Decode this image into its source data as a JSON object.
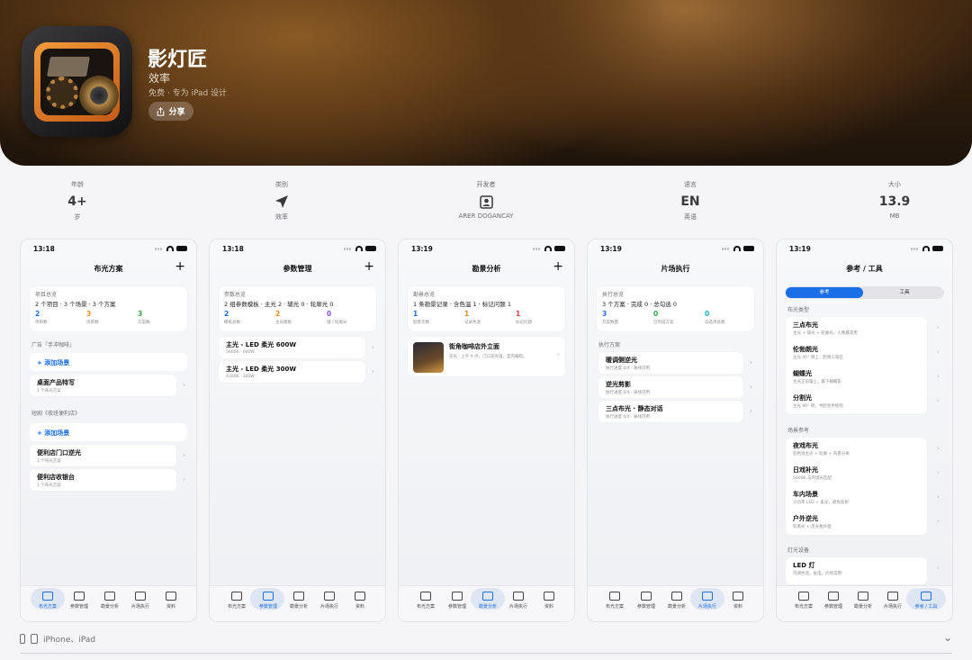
{
  "app": {
    "name": "影灯匠",
    "category": "效率",
    "meta": "免费 · 专为 iPad 设计",
    "share_label": "分享"
  },
  "info": [
    {
      "label": "年龄",
      "value": "4+",
      "sub": "岁"
    },
    {
      "label": "类别",
      "value": "",
      "icon": "paperplane-icon",
      "sub": "效率"
    },
    {
      "label": "开发者",
      "value": "",
      "icon": "person-icon",
      "sub": "ARER DOGANCAY"
    },
    {
      "label": "语言",
      "value": "EN",
      "sub": "英语"
    },
    {
      "label": "大小",
      "value": "13.9",
      "sub": "MB"
    }
  ],
  "tabs": [
    "布光方案",
    "参数管理",
    "勘景分析",
    "片场执行",
    "资料"
  ],
  "tabs5": [
    "布光方案",
    "参数管理",
    "勘景分析",
    "片场执行",
    "参考 / 工具"
  ],
  "s1": {
    "time": "13:18",
    "title": "布光方案",
    "ov_t": "项目总览",
    "ov_s": "2 个项目 · 3 个场景 · 3 个方案",
    "stats": [
      {
        "v": "2",
        "l": "项目数",
        "c": "#1a6ee8"
      },
      {
        "v": "3",
        "l": "场景数",
        "c": "#f08a1a"
      },
      {
        "v": "3",
        "l": "方案数",
        "c": "#28a745"
      }
    ],
    "sec1": "广告「手冲咖啡」",
    "add": "+ 添加场景",
    "r1t": "桌面产品特写",
    "r1s": "1 个布光方案",
    "sec2": "短剧《夜班便利店》",
    "r2t": "便利店门口逆光",
    "r2s": "1 个布光方案",
    "r3t": "便利店收银台",
    "r3s": "1 个布光方案"
  },
  "s2": {
    "time": "13:18",
    "title": "参数管理",
    "ov_t": "参数总览",
    "ov_s": "2 组参数模板 · 主光 2 · 辅光 0 · 轮廓光 0",
    "stats": [
      {
        "v": "2",
        "l": "模板总数",
        "c": "#1a6ee8"
      },
      {
        "v": "2",
        "l": "主光模板",
        "c": "#f08a1a"
      },
      {
        "v": "0",
        "l": "辅 / 轮廓光",
        "c": "#8a4ae8"
      }
    ],
    "r1t": "主光 - LED 柔光 600W",
    "r1s": "5600K · 600W",
    "r2t": "主光 - LED 柔光 300W",
    "r2s": "4300K · 300W"
  },
  "s3": {
    "time": "13:19",
    "title": "勘景分析",
    "ov_t": "勘景总览",
    "ov_s": "1 条勘景记录 · 含色温 1 · 标记问题 1",
    "stats": [
      {
        "v": "1",
        "l": "勘景次数",
        "c": "#1a6ee8"
      },
      {
        "v": "1",
        "l": "记录色温",
        "c": "#f08a1a"
      },
      {
        "v": "1",
        "l": "标记问题",
        "c": "#e83a3a"
      }
    ],
    "rt": "街角咖啡店外立面",
    "rs": "逆光 · 上午 9 点，门口逆光强，室内偏暗。"
  },
  "s4": {
    "time": "13:19",
    "title": "片场执行",
    "ov_t": "执行总览",
    "ov_s": "3 个方案 · 完成 0 · 总勾选 0",
    "stats": [
      {
        "v": "3",
        "l": "方案数量",
        "c": "#1a6ee8"
      },
      {
        "v": "0",
        "l": "已完成方案",
        "c": "#28a745"
      },
      {
        "v": "0",
        "l": "勾选项总数",
        "c": "#17b3c9"
      }
    ],
    "sec": "执行方案",
    "rows": [
      {
        "t": "暖调侧逆光",
        "s": "执行进度 0/4 · 离线可用"
      },
      {
        "t": "逆光剪影",
        "s": "执行进度 0/4 · 离线可用"
      },
      {
        "t": "三点布光 · 静态对话",
        "s": "执行进度 0/4 · 离线可用"
      }
    ]
  },
  "s5": {
    "time": "13:19",
    "title": "参考 / 工具",
    "seg_a": "参考",
    "seg_b": "工具",
    "sec1": "布光类型",
    "g1": [
      {
        "t": "三点布光",
        "s": "主光 + 辅光 + 轮廓光，人像最常用"
      },
      {
        "t": "伦勃朗光",
        "s": "主光 45° 侧上，脸颊三角区"
      },
      {
        "t": "蝴蝶光",
        "s": "主光正前偏上，鼻下蝴蝶影"
      },
      {
        "t": "分割光",
        "s": "主光 90° 侧，半脸亮半脸暗"
      }
    ],
    "sec2": "场景参考",
    "g2": [
      {
        "t": "夜戏布光",
        "s": "低色温主光 + 轮廓 + 背景分离"
      },
      {
        "t": "日戏补光",
        "s": "5600K 与环境光匹配"
      },
      {
        "t": "车内场景",
        "s": "小功率 LED + 柔光，避免反射"
      },
      {
        "t": "户外逆光",
        "s": "轮廓光 + 反光板补面"
      }
    ],
    "sec3": "灯光设备",
    "g3t": "LED 灯",
    "g3s": "可调色温，省电，片场常用"
  },
  "footer": {
    "devices": "iPhone、iPad"
  },
  "colors": {
    "accent": "#1a6ee8"
  }
}
